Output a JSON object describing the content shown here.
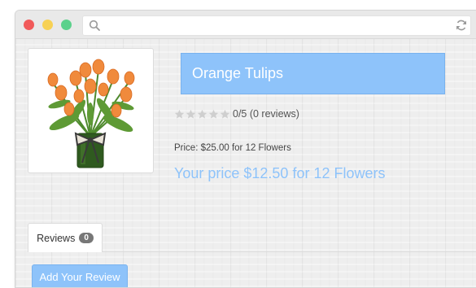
{
  "browser": {
    "address": "",
    "icons": {
      "search": "search-icon",
      "refresh": "refresh-icon"
    }
  },
  "product": {
    "name": "Orange Tulips",
    "image": "orange-tulips-bouquet-image",
    "rating": {
      "value": 0,
      "max": 5,
      "text": "0/5 (0 reviews)"
    },
    "price_text": "Price: $25.00 for 12 Flowers",
    "your_price_text": "Your price $12.50 for 12 Flowers"
  },
  "tabs": [
    {
      "label": "Reviews",
      "count": "0"
    }
  ],
  "actions": {
    "add_review": "Add Your Review"
  },
  "colors": {
    "accent": "#8ec3fa",
    "star_empty": "#cfcfcf",
    "badge": "#777777"
  }
}
